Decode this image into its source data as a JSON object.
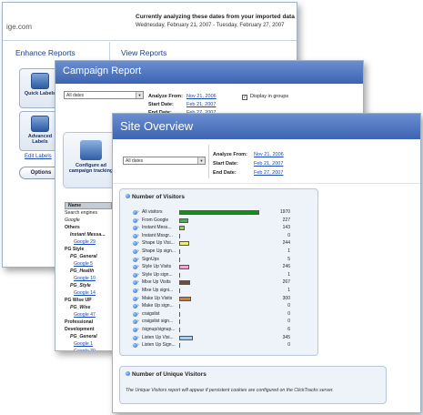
{
  "back_window": {
    "logo_text": "ige.com",
    "analyzing": "Currently analyzing these dates from your imported data",
    "dates": "Wednesday, February 21, 2007 - Tuesday, February 27, 2007",
    "left_heading": "Enhance Reports",
    "right_heading": "View Reports",
    "quick_labels": "Quick Labels",
    "advanced_labels": "Advanced Labels",
    "edit_labels": "Edit Labels",
    "options": "Options"
  },
  "campaign_window": {
    "title": "Campaign Report",
    "date_select": "All dates",
    "analyze_from_label": "Analyze From:",
    "analyze_from": "Nov 21, 2006",
    "start_label": "Start Date:",
    "start": "Feb 21, 2007",
    "end_label": "End Date:",
    "end": "Feb 27, 2007",
    "display_groups": "Display in groups",
    "configure_label": "Configure ad campaign tracking",
    "tree_header": "Name",
    "tree": [
      {
        "text": "Search engines",
        "style": "plain"
      },
      {
        "text": "Google",
        "style": "i"
      },
      {
        "text": "Others",
        "style": "b"
      },
      {
        "text": "Instant Messa...",
        "style": "bi"
      },
      {
        "text": "Google 29",
        "style": "lk"
      },
      {
        "text": "PG Style",
        "style": "b"
      },
      {
        "text": "PG_General",
        "style": "bi"
      },
      {
        "text": "Google 5",
        "style": "lk"
      },
      {
        "text": "PG_Health",
        "style": "bi"
      },
      {
        "text": "Google 10",
        "style": "lk"
      },
      {
        "text": "PG_Style",
        "style": "bi"
      },
      {
        "text": "Google 14",
        "style": "lk"
      },
      {
        "text": "PG Wise UP",
        "style": "b"
      },
      {
        "text": "PG_Wise",
        "style": "bi"
      },
      {
        "text": "Google 47",
        "style": "lk"
      },
      {
        "text": "Professional",
        "style": "b"
      },
      {
        "text": "Development",
        "style": "b"
      },
      {
        "text": "PG_General",
        "style": "bi"
      },
      {
        "text": "Google 1",
        "style": "lk"
      },
      {
        "text": "Google 30",
        "style": "lk"
      },
      {
        "text": "Relationship",
        "style": "b"
      }
    ]
  },
  "site_window": {
    "title": "Site Overview",
    "date_select": "All dates",
    "analyze_from_label": "Analyze From:",
    "analyze_from": "Nov 21, 2006",
    "start_label": "Start Date:",
    "start": "Feb 21, 2007",
    "end_label": "End Date:",
    "end": "Feb 27, 2007",
    "visitors_title": "Number of Visitors",
    "unique_title": "Number of Unique Visitors",
    "unique_text": "The Unique Visitors report will appear if persistent cookies are configured on the ClickTracks server."
  },
  "chart_data": {
    "type": "bar",
    "categories": [
      "All visitors",
      "From Google",
      "Instant Mess...",
      "Instant Mssgr...",
      "Shape Up Visi...",
      "Shape Up sign...",
      "SignUps",
      "Style Up Visits",
      "Style Up sign...",
      "Mixe Up Visits",
      "Mixe Up signi...",
      "Make Up Visits",
      "Make Up sign...",
      "craigslist",
      "craigslist sign...",
      "/signup/signup...",
      "Listen Up Visi...",
      "Listen Up Sign..."
    ],
    "values": [
      1970,
      227,
      143,
      0,
      244,
      1,
      5,
      246,
      1,
      267,
      1,
      300,
      0,
      0,
      0,
      6,
      345,
      0
    ],
    "colors": [
      "#1a8a1a",
      "#2fbf3a",
      "#8fd63b",
      "#cfd0d0",
      "#f4ec7a",
      "#f0ea8c",
      "#c2c2c2",
      "#f2a8d2",
      "#e8c2dc",
      "#7a4a2a",
      "#a06844",
      "#e27a1a",
      "#e8a060",
      "#cccccc",
      "#cccccc",
      "#cccccc",
      "#a8cdf0",
      "#cccccc"
    ],
    "xlim": [
      0,
      1970
    ]
  }
}
